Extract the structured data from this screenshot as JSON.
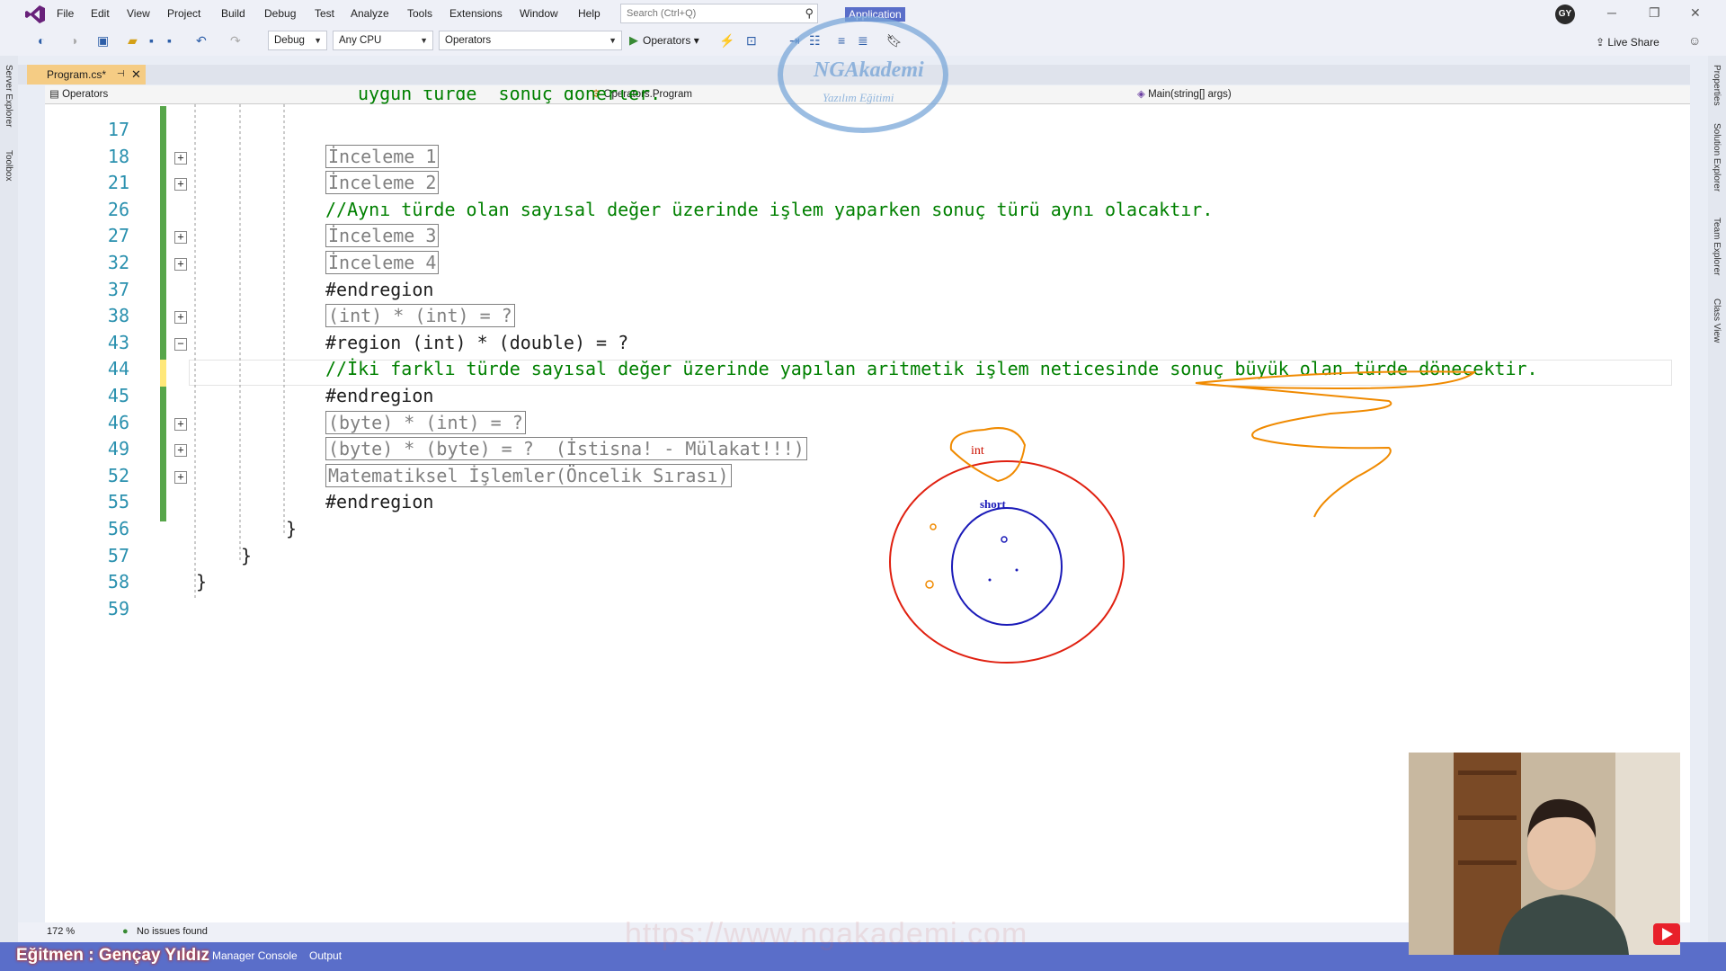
{
  "menubar": {
    "items": [
      "File",
      "Edit",
      "View",
      "Project",
      "Build",
      "Debug",
      "Test",
      "Analyze",
      "Tools",
      "Extensions",
      "Window",
      "Help"
    ],
    "search_placeholder": "Search (Ctrl+Q)",
    "app_label": "Application",
    "avatar": "GY"
  },
  "toolbar": {
    "config": "Debug",
    "platform": "Any CPU",
    "project": "Operators",
    "run_label": "Operators",
    "live_share": "Live Share"
  },
  "side_tabs": {
    "left": [
      "Server Explorer",
      "Toolbox"
    ],
    "right": [
      "Properties",
      "Solution Explorer",
      "Team Explorer",
      "Class View"
    ]
  },
  "doc_tab": {
    "label": "Program.cs*"
  },
  "navbar": {
    "project": "Operators",
    "class": "Operators.Program",
    "member": "Main(string[] args)"
  },
  "watermark": {
    "line1": "NGAkademi",
    "line2": "Yazılım Eğitimi"
  },
  "code": {
    "partial_top": "uygun türde  sonuç dönerler.",
    "lines": [
      {
        "n": "17",
        "text": "",
        "kind": "plain",
        "fold": ""
      },
      {
        "n": "18",
        "text": "İnceleme 1",
        "kind": "region",
        "fold": "+"
      },
      {
        "n": "21",
        "text": "İnceleme 2",
        "kind": "region",
        "fold": "+"
      },
      {
        "n": "26",
        "text": "//Aynı türde olan sayısal değer üzerinde işlem yaparken sonuç türü aynı olacaktır.",
        "kind": "comment",
        "fold": ""
      },
      {
        "n": "27",
        "text": "İnceleme 3",
        "kind": "region",
        "fold": "+"
      },
      {
        "n": "32",
        "text": "İnceleme 4",
        "kind": "region",
        "fold": "+"
      },
      {
        "n": "37",
        "text": "#endregion",
        "kind": "plain",
        "fold": ""
      },
      {
        "n": "38",
        "text": "(int) * (int) = ?",
        "kind": "region",
        "fold": "+"
      },
      {
        "n": "43",
        "text": "#region (int) * (double) = ?",
        "kind": "plain",
        "fold": "-"
      },
      {
        "n": "44",
        "text": "//İki farklı türde sayısal değer üzerinde yapılan aritmetik işlem neticesinde sonuç büyük olan türde dönecektir.",
        "kind": "comment",
        "fold": ""
      },
      {
        "n": "45",
        "text": "#endregion",
        "kind": "plain",
        "fold": ""
      },
      {
        "n": "46",
        "text": "(byte) * (int) = ?",
        "kind": "region",
        "fold": "+"
      },
      {
        "n": "49",
        "text": "(byte) * (byte) = ?  (İstisna! - Mülakat!!!)",
        "kind": "region",
        "fold": "+"
      },
      {
        "n": "52",
        "text": "Matematiksel İşlemler(Öncelik Sırası)",
        "kind": "region",
        "fold": "+"
      },
      {
        "n": "55",
        "text": "#endregion",
        "kind": "plain",
        "fold": ""
      },
      {
        "n": "56",
        "text": "}",
        "kind": "plain",
        "fold": ""
      },
      {
        "n": "57",
        "text": "}",
        "kind": "plain",
        "fold": ""
      },
      {
        "n": "58",
        "text": "}",
        "kind": "plain",
        "fold": ""
      },
      {
        "n": "59",
        "text": "",
        "kind": "plain",
        "fold": ""
      }
    ]
  },
  "annotations": {
    "outer": "int",
    "inner": "short"
  },
  "status": {
    "zoom": "172 %",
    "issues": "No issues found"
  },
  "bottom": {
    "trainer": "Eğitmen : Gençay Yıldız",
    "tabs": [
      "Manager Console",
      "Output"
    ],
    "url_watermark": "https://www.ngakademi.com"
  },
  "colors": {
    "accent": "#5a6ec9",
    "tab_active": "#f5cc84",
    "comment": "#008000",
    "line_number": "#2b91af"
  }
}
